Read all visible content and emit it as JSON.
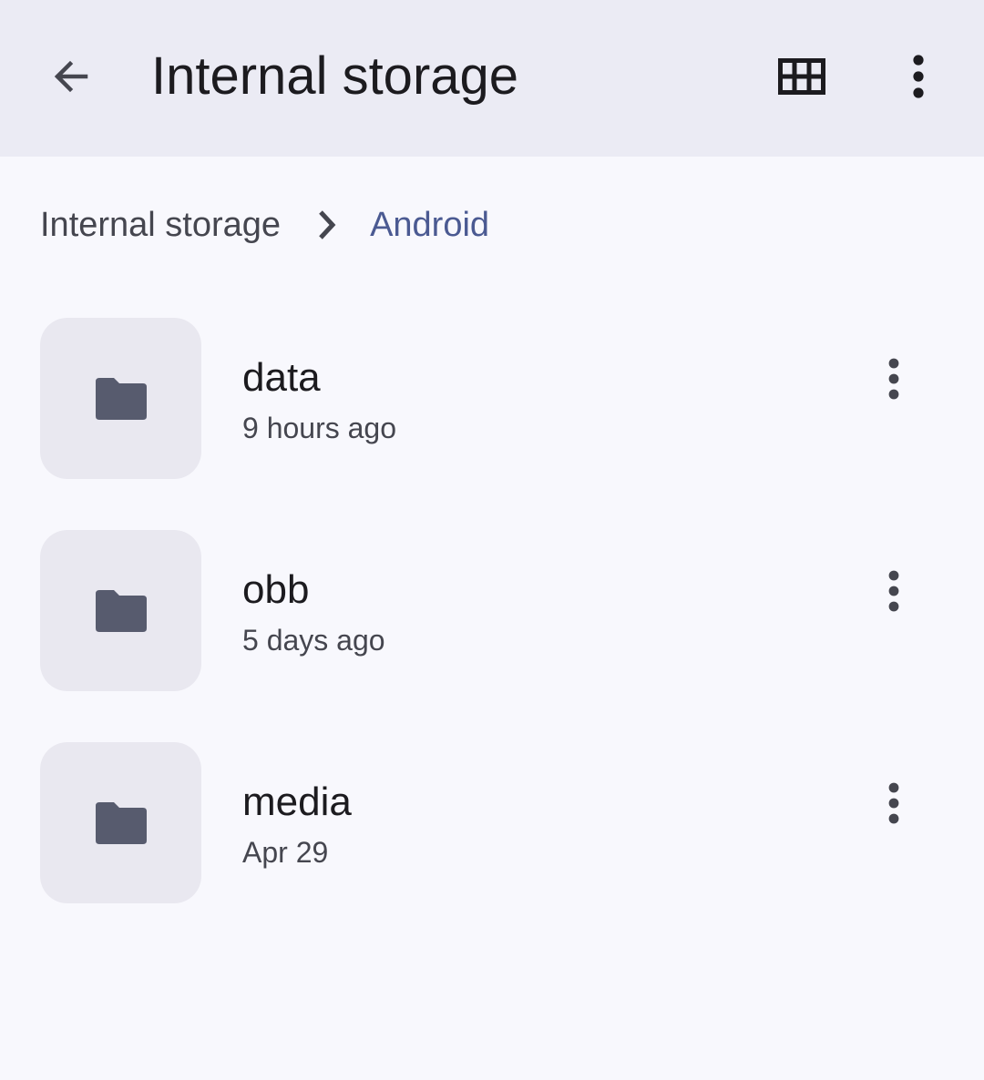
{
  "app_bar": {
    "title": "Internal storage",
    "back_icon": "arrow-back-icon",
    "view_icon": "grid-view-icon",
    "menu_icon": "more-vert-icon"
  },
  "breadcrumb": {
    "root": "Internal storage",
    "separator_icon": "chevron-right-icon",
    "current": "Android"
  },
  "files": [
    {
      "name": "data",
      "modified": "9 hours ago",
      "icon": "folder-icon"
    },
    {
      "name": "obb",
      "modified": "5 days ago",
      "icon": "folder-icon"
    },
    {
      "name": "media",
      "modified": "Apr 29",
      "icon": "folder-icon"
    }
  ],
  "colors": {
    "app_bar_bg": "#ebebf4",
    "page_bg": "#f8f8fd",
    "accent": "#4b5a92",
    "folder_icon": "#575b6e",
    "tile_bg": "#e9e8f0"
  }
}
